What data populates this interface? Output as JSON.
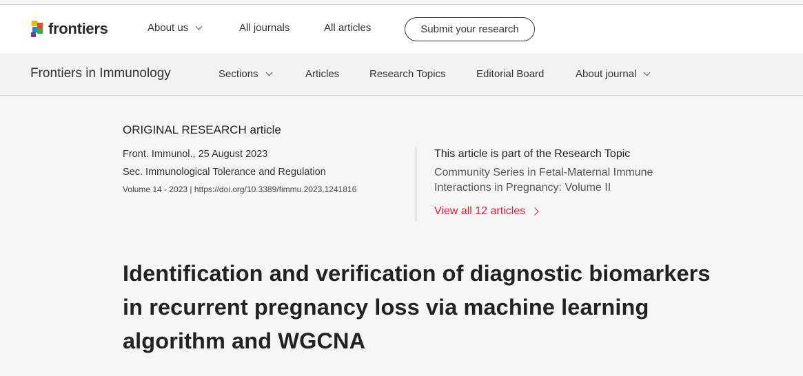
{
  "brand": {
    "name": "frontiers",
    "logo_icon": "frontiers-logo-icon"
  },
  "topnav": {
    "about_us": "About us",
    "all_journals": "All journals",
    "all_articles": "All articles",
    "submit": "Submit your research"
  },
  "subnav": {
    "journal": "Frontiers in Immunology",
    "sections": "Sections",
    "articles": "Articles",
    "research_topics": "Research Topics",
    "editorial_board": "Editorial Board",
    "about_journal": "About journal"
  },
  "article": {
    "type": "ORIGINAL RESEARCH article",
    "published": "Front. Immunol., 25 August 2023",
    "section": "Sec. Immunological Tolerance and Regulation",
    "volume_doi": "Volume 14 - 2023 | https://doi.org/10.3389/fimmu.2023.1241816",
    "title": "Identification and verification of diagnostic biomarkers in recurrent pregnancy loss via machine learning algorithm and WGCNA"
  },
  "research_topic": {
    "label": "This article is part of the Research Topic",
    "title": "Community Series in Fetal-Maternal Immune Interactions in Pregnancy: Volume II",
    "view_all": "View all 12 articles"
  },
  "colors": {
    "accent_red": "#d9233b"
  }
}
